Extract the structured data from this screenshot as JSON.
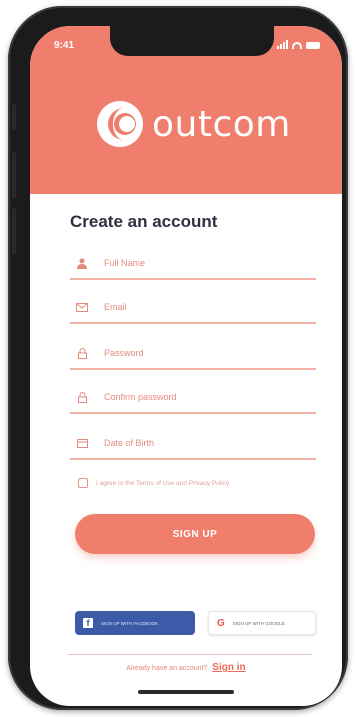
{
  "status_bar": {
    "time": "9:41"
  },
  "brand": {
    "name": "outcom",
    "color": "#ef7f6c"
  },
  "form": {
    "title": "Create an account",
    "fields": [
      {
        "label": "Full Name",
        "icon": "user-icon"
      },
      {
        "label": "Email",
        "icon": "mail-icon"
      },
      {
        "label": "Password",
        "icon": "lock-icon"
      },
      {
        "label": "Confirm password",
        "icon": "lock-icon"
      },
      {
        "label": "Date of Birth",
        "icon": "calendar-icon"
      }
    ],
    "terms_text": "I agree to the Terms of Use and Privacy Policy",
    "signup_label": "SIGN UP"
  },
  "social": {
    "facebook_label": "SIGN UP WITH FACEBOOK",
    "google_label": "SIGN UP WITH GOOGLE",
    "facebook_color": "#3c5aa8"
  },
  "footer": {
    "prompt": "Already have an account?",
    "signin_label": "Sign in"
  }
}
